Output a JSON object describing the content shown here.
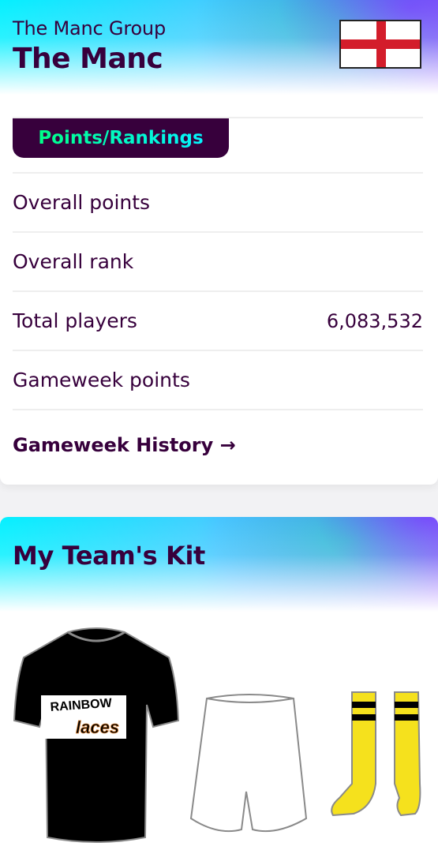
{
  "header": {
    "subtitle": "The Manc Group",
    "title": "The Manc",
    "flag_icon": "england-flag-icon"
  },
  "tabs": [
    {
      "label": "Points/Rankings",
      "active": true
    }
  ],
  "stats": [
    {
      "label": "Overall points",
      "value": ""
    },
    {
      "label": "Overall rank",
      "value": ""
    },
    {
      "label": "Total players",
      "value": "6,083,532"
    },
    {
      "label": "Gameweek points",
      "value": ""
    }
  ],
  "history_link": "Gameweek History →",
  "kit": {
    "title": "My Team's Kit",
    "shirt_text_top": "RAINBOW",
    "shirt_text_bottom": "laces",
    "shirt_color": "#000000",
    "shorts_color": "#ffffff",
    "socks_color": "#f5e11d",
    "socks_stripe_color": "#000000"
  },
  "colors": {
    "brand": "#37003c",
    "accent_green": "#00ff87",
    "accent_cyan": "#04f5ff",
    "flag_red": "#d31d2b"
  }
}
